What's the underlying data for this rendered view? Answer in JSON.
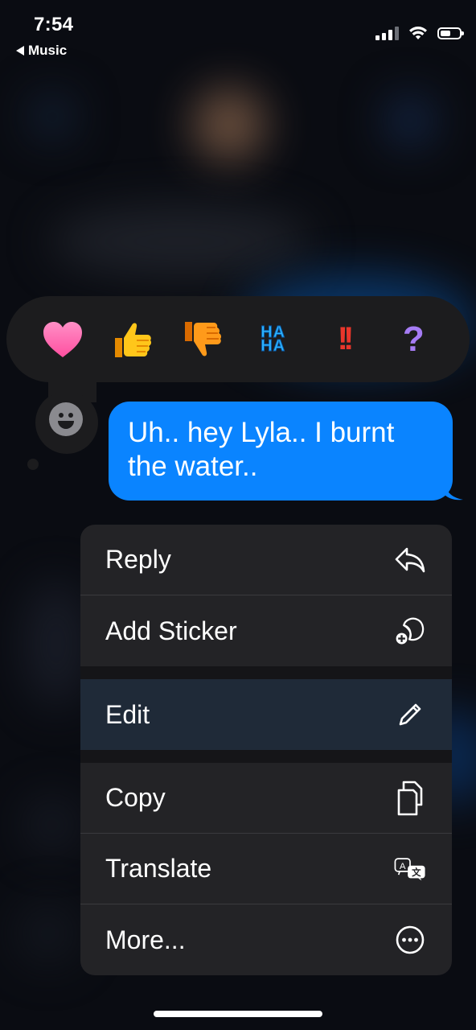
{
  "status_bar": {
    "time": "7:54",
    "back_app": "Music"
  },
  "reactions": [
    {
      "name": "heart",
      "icon": "heart-icon"
    },
    {
      "name": "thumbs-up",
      "icon": "thumbs-up-icon"
    },
    {
      "name": "thumbs-down",
      "icon": "thumbs-down-icon"
    },
    {
      "name": "haha",
      "text_top": "HA",
      "text_bottom": "HA"
    },
    {
      "name": "exclamation",
      "text": "!!"
    },
    {
      "name": "question",
      "text": "?"
    }
  ],
  "message": {
    "text": "Uh.. hey Lyla.. I burnt the water..",
    "color": "#0a84ff"
  },
  "menu": {
    "items": [
      {
        "label": "Reply",
        "icon": "reply-icon"
      },
      {
        "label": "Add Sticker",
        "icon": "add-sticker-icon"
      },
      {
        "label": "Edit",
        "icon": "pencil-icon"
      },
      {
        "label": "Copy",
        "icon": "copy-icon"
      },
      {
        "label": "Translate",
        "icon": "translate-icon"
      },
      {
        "label": "More...",
        "icon": "more-icon"
      }
    ]
  }
}
